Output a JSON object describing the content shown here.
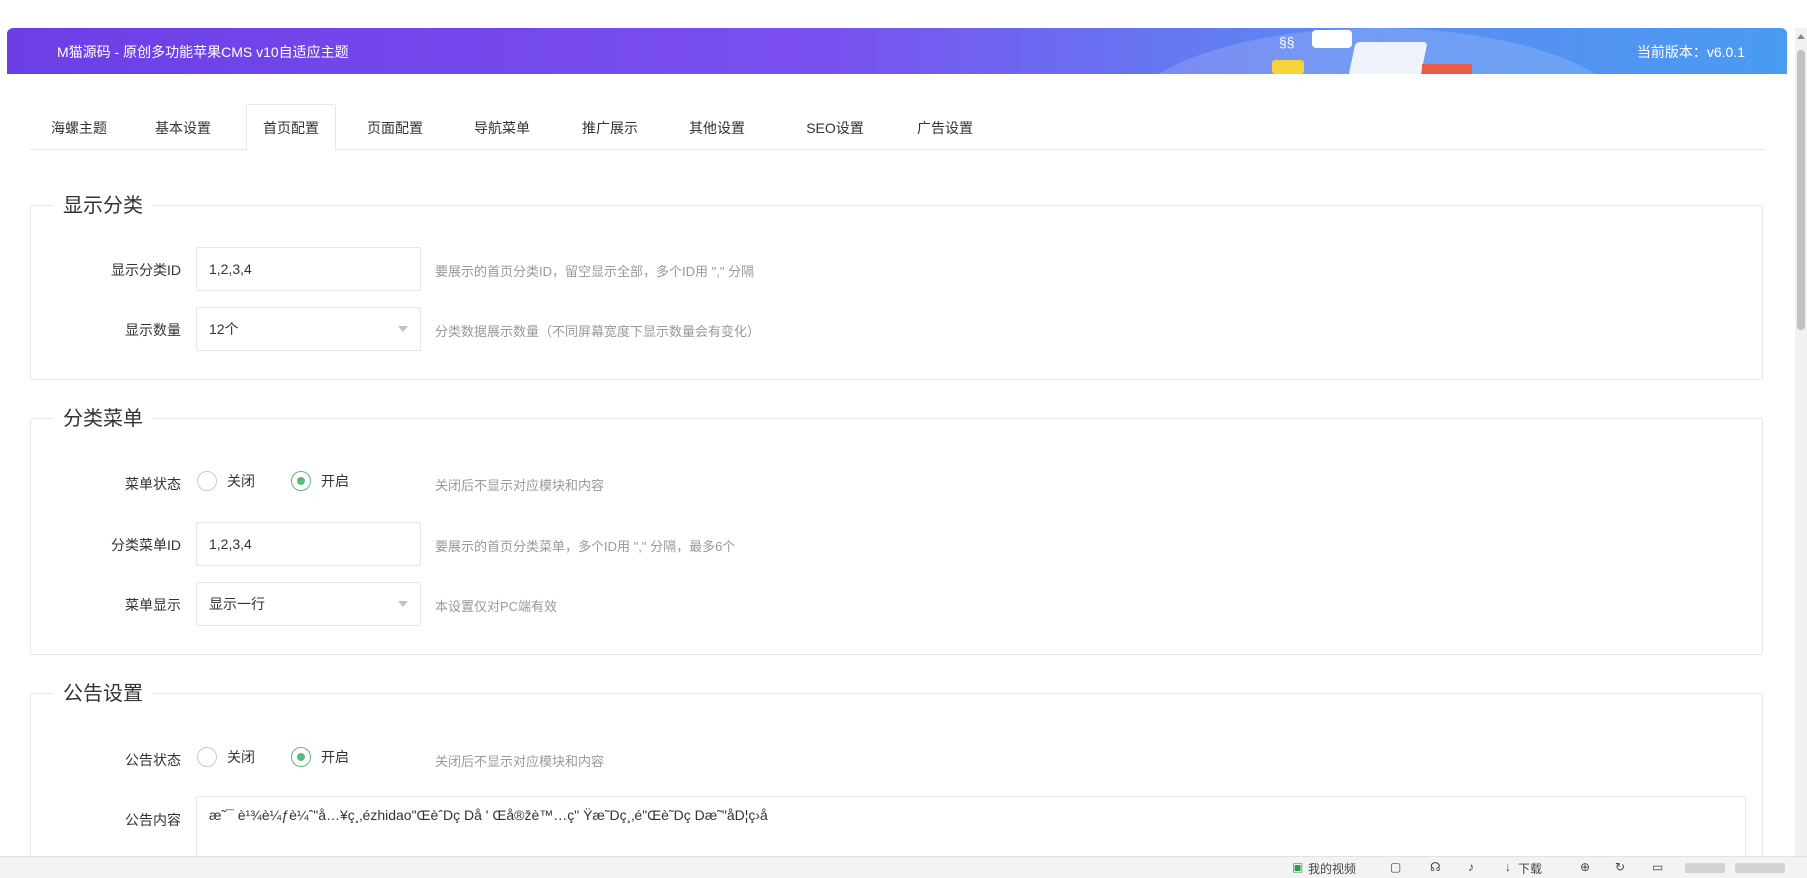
{
  "header": {
    "title": "M猫源码 - 原创多功能苹果CMS v10自适应主题",
    "version": "当前版本：v6.0.1"
  },
  "tabs": [
    "海螺主题",
    "基本设置",
    "首页配置",
    "页面配置",
    "导航菜单",
    "推广展示",
    "其他设置",
    "SEO设置",
    "广告设置"
  ],
  "active_tab": "首页配置",
  "sections": {
    "category": {
      "legend": "显示分类",
      "id_label": "显示分类ID",
      "id_value": "1,2,3,4",
      "id_hint": "要展示的首页分类ID，留空显示全部，多个ID用 \",\" 分隔",
      "count_label": "显示数量",
      "count_value": "12个",
      "count_hint": "分类数据展示数量（不同屏幕宽度下显示数量会有变化）"
    },
    "menu": {
      "legend": "分类菜单",
      "status_label": "菜单状态",
      "off_label": "关闭",
      "on_label": "开启",
      "status_selected": "开启",
      "status_hint": "关闭后不显示对应模块和内容",
      "id_label": "分类菜单ID",
      "id_value": "1,2,3,4",
      "id_hint": "要展示的首页分类菜单，多个ID用 \",\" 分隔，最多6个",
      "display_label": "菜单显示",
      "display_value": "显示一行",
      "display_hint": "本设置仅对PC端有效"
    },
    "notice": {
      "legend": "公告设置",
      "status_label": "公告状态",
      "off_label": "关闭",
      "on_label": "开启",
      "status_selected": "开启",
      "status_hint": "关闭后不显示对应模块和内容",
      "content_label": "公告内容",
      "content_value": "æ˜¯ è¹¾è¼ƒè¼ˆ\"å…¥ç¸‚ézhidao\"ŒèˆDç Då ' Œå®žè™…ç\" Ÿæ˜Dç¸‚é\"Œè˜Dç Dæ˜\"åD¦ç›å"
    }
  },
  "statusbar": {
    "items": [
      "我的视频",
      "下载"
    ]
  },
  "colors": {
    "accent_green": "#5fb878",
    "banner_start": "#6c3fe6",
    "banner_end": "#4a9bf2"
  }
}
